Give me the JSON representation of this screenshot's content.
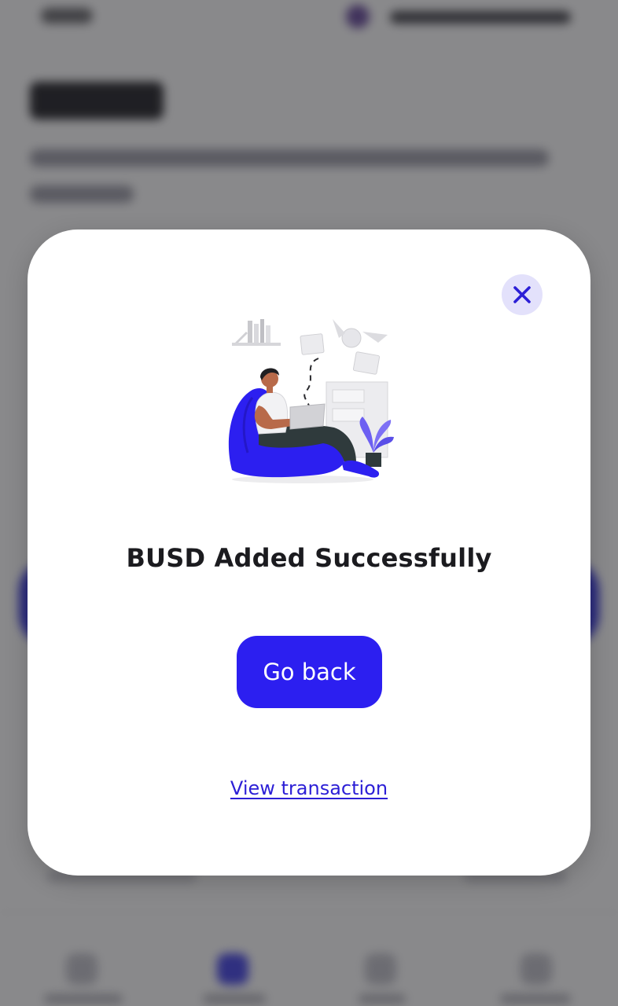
{
  "modal": {
    "title": "BUSD Added Successfully",
    "primary_button": "Go back",
    "secondary_link": "View transaction",
    "close_icon": "close-icon",
    "illustration": "person-on-beanbag-with-laptop-illustration"
  },
  "colors": {
    "accent": "#2c1ff0",
    "close_bg": "#e3e1fb",
    "title_text": "#1b1b1f",
    "overlay": "rgba(20,20,24,0.48)"
  }
}
